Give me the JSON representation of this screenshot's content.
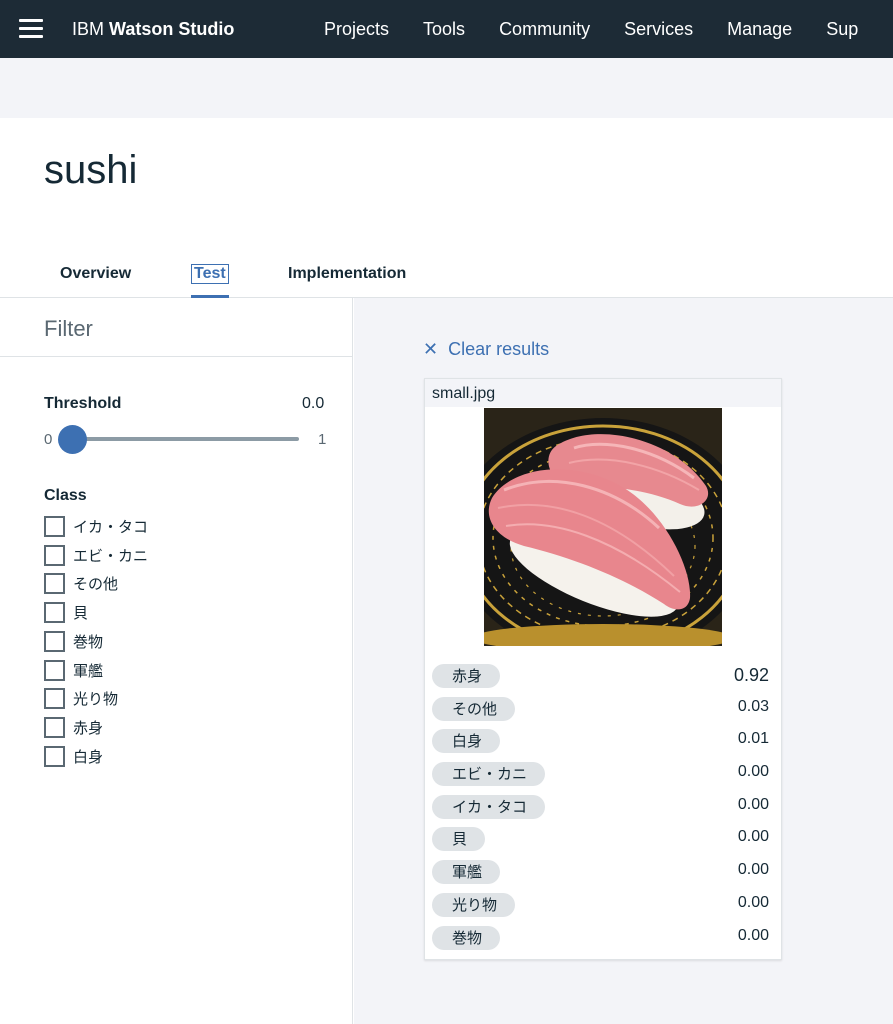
{
  "nav": {
    "brand_ibm": "IBM",
    "brand_product": "Watson Studio",
    "links": [
      "Projects",
      "Tools",
      "Community",
      "Services",
      "Manage",
      "Sup"
    ]
  },
  "page": {
    "title": "sushi"
  },
  "tabs": [
    "Overview",
    "Test",
    "Implementation"
  ],
  "filter": {
    "title": "Filter",
    "threshold_label": "Threshold",
    "threshold_value": "0.0",
    "slider_min": "0",
    "slider_max": "1",
    "slider_level": 0.0,
    "class_label": "Class",
    "classes": [
      "イカ・タコ",
      "エビ・カニ",
      "その他",
      "貝",
      "巻物",
      "軍艦",
      "光り物",
      "赤身",
      "白身"
    ]
  },
  "results": {
    "clear_label": "Clear results",
    "filename": "small.jpg",
    "scores": [
      {
        "label": "赤身",
        "value": "0.92"
      },
      {
        "label": "その他",
        "value": "0.03"
      },
      {
        "label": "白身",
        "value": "0.01"
      },
      {
        "label": "エビ・カニ",
        "value": "0.00"
      },
      {
        "label": "イカ・タコ",
        "value": "0.00"
      },
      {
        "label": "貝",
        "value": "0.00"
      },
      {
        "label": "軍艦",
        "value": "0.00"
      },
      {
        "label": "光り物",
        "value": "0.00"
      },
      {
        "label": "巻物",
        "value": "0.00"
      }
    ]
  },
  "colors": {
    "nav_bg": "#1d2b36",
    "accent": "#3d70b2",
    "panel_bg": "#f3f4f8",
    "pill_bg": "#dfe3e6"
  },
  "icons": {
    "menu": "hamburger-menu-icon",
    "clear": "close-icon"
  }
}
